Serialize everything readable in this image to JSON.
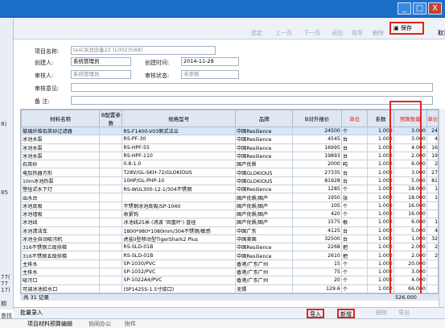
{
  "window": {
    "minimize": "_",
    "maximize": "□",
    "close": "X"
  },
  "left": {
    "labels": [
      "8)",
      "85",
      "77(",
      "77",
      "17)",
      "期",
      "查找"
    ]
  },
  "toolbar": {
    "buttons": [
      "选定",
      "上一页",
      "下一页",
      "返回",
      "指导",
      "删除",
      "编辑"
    ],
    "save": "保存",
    "cancel": "取消"
  },
  "form": {
    "project_name_label": "项目名称:",
    "project_name": "test冰池设备22 (L0023568)",
    "creator_label": "创建人:",
    "creator": "系统管理员",
    "created_label": "创建时间:",
    "created": "2014-11-28",
    "reviewer_label": "审核人:",
    "reviewer": "系统管理员",
    "status_label": "审核状态:",
    "status": "未审核",
    "opinion_label": "审核意见:",
    "remark_label": "备  注:"
  },
  "table": {
    "headers": [
      "材料名称",
      "B配置参数",
      "规格型号",
      "品牌",
      "B对外报价",
      "单位",
      "系数",
      "预算数量",
      "单价"
    ],
    "rows": [
      [
        "玻璃纤维石英砂过滤器",
        "",
        "RS-F1400-V03侧式法兰",
        "中国Resilience",
        "24500",
        "个",
        "1.000",
        "3.000",
        "24"
      ],
      [
        "冰池水泵",
        "",
        "RS-PF-30",
        "中国Resilience",
        "4545",
        "台",
        "1.000",
        "3.000",
        "4"
      ],
      [
        "冰池水泵",
        "",
        "RS-HPF-55",
        "中国Resilience",
        "16995",
        "台",
        "1.000",
        "4.000",
        "16"
      ],
      [
        "冰池水泵",
        "",
        "RS-HPF-110",
        "中国Resilience",
        "19893",
        "台",
        "1.000",
        "2.000",
        "19"
      ],
      [
        "石英砂",
        "",
        "0.8-1.0",
        "国产优质",
        "2000",
        "吨",
        "1.000",
        "6.000",
        "2"
      ],
      [
        "电加热器方形",
        "",
        "T28V/GL-SKH-72/GLOKIOUS",
        "中国GLOKIOUS",
        "27335",
        "台",
        "1.000",
        "3.000",
        "27"
      ],
      [
        "10m冰池热泵",
        "",
        "10HP/GL-PHP-10",
        "中国GLOKIOUS",
        "81928",
        "台",
        "1.000",
        "5.000",
        "81"
      ],
      [
        "壁挂式水下灯",
        "",
        "RS-WUL300-12-1/304不锈钢",
        "中国Resilience",
        "1285",
        "个",
        "1.000",
        "18.000",
        "1"
      ],
      [
        "出水台",
        "",
        "",
        "国产优质/国产",
        "1950",
        "张",
        "1.000",
        "18.000",
        "1"
      ],
      [
        "冰池底吸",
        "",
        "不锈钢冰池底吸/SP-1040",
        "国产优质/国产",
        "105",
        "个",
        "1.000",
        "16.000",
        ""
      ],
      [
        "冰池墙吸",
        "",
        "收紧钩",
        "国产优质/国产",
        "420",
        "个",
        "1.000",
        "16.000",
        ""
      ],
      [
        "冰池线",
        "",
        "冰池线25米 (消波 '凤凰叶') 直径",
        "国产优质/国产",
        "1575",
        "根",
        "1.000",
        "6.000",
        "1"
      ],
      [
        "冰池清洁车",
        "",
        "1800*980*1080mm/304不锈钢/敏感",
        "中国广东",
        "4125",
        "台",
        "1.000",
        "5.000",
        "4"
      ],
      [
        "冰池全自动吸污机",
        "",
        "虎鲨II型移动型TigerShark2 Plus",
        "中国美国",
        "32500",
        "台",
        "1.000",
        "1.000",
        "32"
      ],
      [
        "316不锈钢三级扶梯",
        "",
        "RS-SLD-01B",
        "中国Resilience",
        "2268",
        "把",
        "1.000",
        "2.000",
        "2"
      ],
      [
        "316不锈钢五级扶梯",
        "",
        "RS-SLD-01B",
        "中国Resilience",
        "2610",
        "把",
        "1.000",
        "2.000",
        "2"
      ],
      [
        "主排水",
        "",
        "SP-1030/PVC",
        "香港/广东广州",
        "15",
        "个",
        "1.000",
        "20.000",
        ""
      ],
      [
        "主排水",
        "",
        "SP-1032/PVC",
        "香港/广东广州",
        "75",
        "个",
        "1.000",
        "3.000",
        ""
      ],
      [
        "吸污口",
        "",
        "SP-1022A4/PVC",
        "香港/广东广州",
        "20",
        "个",
        "1.000",
        "4.000",
        ""
      ],
      [
        "可调冰池给水口",
        "",
        "(SP1425S-1.5寸接口)",
        "无锡",
        "129.6",
        "个",
        "1.000",
        "66.000",
        ""
      ]
    ],
    "footer_count": "共 31 记录",
    "footer_total": "526.000"
  },
  "bottom": {
    "batch": "批量录入",
    "import": "导入",
    "add": "新增",
    "other": [
      "删除",
      "导出"
    ]
  },
  "tabs": [
    "项目材料预算编辑",
    "协同办公",
    "附件"
  ]
}
